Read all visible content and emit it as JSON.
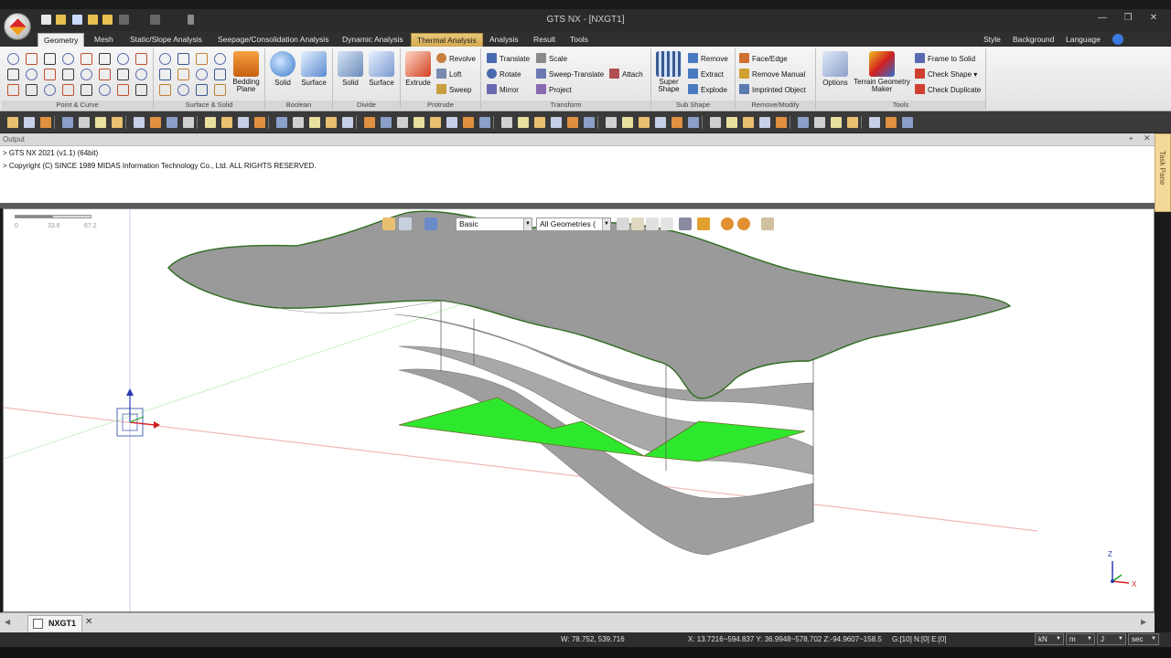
{
  "window": {
    "title": "GTS NX - [NXGT1]"
  },
  "ribbon": {
    "tabs": [
      "Geometry",
      "Mesh",
      "Static/Slope Analysis",
      "Seepage/Consolidation Analysis",
      "Dynamic Analysis",
      "Thermal Analysis",
      "Analysis",
      "Result",
      "Tools"
    ],
    "right_menu": {
      "style": "Style",
      "background": "Background",
      "language": "Language"
    },
    "groups": {
      "point_curve": "Point & Curve",
      "surface_solid": "Surface & Solid",
      "boolean": "Boolean",
      "divide": "Divide",
      "protrude": "Protrude",
      "transform": "Transform",
      "sub_shape": "Sub Shape",
      "remove_modify": "Remove/Modify",
      "tools": "Tools"
    },
    "buttons": {
      "bedding_plane": "Bedding Plane",
      "boolean_solid": "Solid",
      "boolean_surface": "Surface",
      "divide_solid": "Solid",
      "divide_surface": "Surface",
      "extrude": "Extrude",
      "revolve": "Revolve",
      "loft": "Loft",
      "sweep": "Sweep",
      "translate": "Translate",
      "scale": "Scale",
      "rotate": "Rotate",
      "sweep_translate": "Sweep-Translate",
      "attach": "Attach",
      "mirror": "Mirror",
      "project": "Project",
      "super_shape": "Super Shape",
      "remove": "Remove",
      "extract": "Extract",
      "explode": "Explode",
      "face_edge": "Face/Edge",
      "remove_manual": "Remove Manual",
      "imprinted_object": "Imprinted Object",
      "options": "Options",
      "terrain_geometry_maker": "Terrain Geometry Maker",
      "frame_to_solid": "Frame to Solid",
      "check_shape": "Check Shape",
      "check_duplicate": "Check Duplicate"
    }
  },
  "output": {
    "title": "Output",
    "lines": [
      "> GTS NX 2021 (v1.1) (64bit)",
      "> Copyright (C) SINCE 1989 MIDAS Information Technology Co., Ltd. ALL RIGHTS RESERVED."
    ]
  },
  "task_pane": {
    "label": "Task Pane"
  },
  "viewport": {
    "scale_labels": [
      "0",
      "33.6",
      "67.2"
    ],
    "display_mode": "Basic",
    "filter": "All Geometries (",
    "axis_labels": {
      "z": "Z",
      "x": "X"
    }
  },
  "document_tab": {
    "label": "NXGT1"
  },
  "status": {
    "window_coords": "W: 78.752, 539.716",
    "cursor_coords": "X: 13.7216~594.837 Y: 36.9948~578.702 Z:-94.9607~158.5",
    "counts": "G:[10] N:[0] E:[0]",
    "units": {
      "force": "kN",
      "length": "m",
      "energy": "J",
      "time": "sec"
    }
  },
  "colors": {
    "surface_gray": "#9a9a9a",
    "highlight_green": "#2ee82e",
    "edge_green": "#2f6b1f",
    "accent_tab": "#d4a850"
  }
}
